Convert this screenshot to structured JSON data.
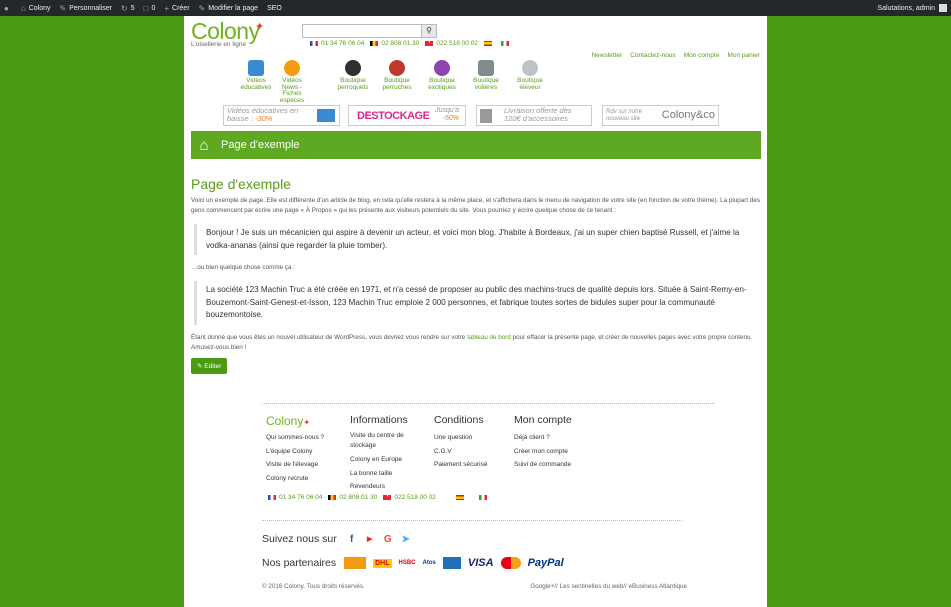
{
  "adminbar": {
    "site": "Colony",
    "customize": "Personnaliser",
    "updates": "5",
    "comments": "0",
    "new": "Créer",
    "edit_page": "Modifier la page",
    "seo": "SEO",
    "greeting": "Salutations, admin"
  },
  "header": {
    "logo": "Colony",
    "tagline": "L'oisellerie en ligne",
    "search_placeholder": "",
    "phones": [
      "01 34 76 06 04",
      "02 808 01 30",
      "022 518 00 02"
    ],
    "links": [
      "Newsletter",
      "Contactez-nous",
      "Mon compte",
      "Mon panier"
    ],
    "cats": [
      {
        "l1": "Vidéos",
        "l2": "éducatives",
        "l3": "",
        "l4": "",
        "color": "#3b8ad1"
      },
      {
        "l1": "Vidéos",
        "l2": "News -",
        "l3": "Fiches",
        "l4": "espèces",
        "color": "#f39c12"
      },
      {
        "l1": "Boutique",
        "l2": "perroquets",
        "l3": "",
        "l4": "",
        "color": "#2f2f2f"
      },
      {
        "l1": "Boutique",
        "l2": "perruches",
        "l3": "",
        "l4": "",
        "color": "#c0392b"
      },
      {
        "l1": "Boutique",
        "l2": "exotiques",
        "l3": "",
        "l4": "",
        "color": "#8e44ad"
      },
      {
        "l1": "Boutique",
        "l2": "volières",
        "l3": "",
        "l4": "",
        "color": "#7f8c8d"
      },
      {
        "l1": "Boutique",
        "l2": "éleveur",
        "l3": "",
        "l4": "",
        "color": "#bdc3c7"
      }
    ],
    "promos": [
      {
        "a": "Vidéos éducatives en",
        "b": "baisse :",
        "c": "-30%"
      },
      {
        "a": "DESTOCKAGE",
        "b": "Jusqu'à",
        "c": "-50%"
      },
      {
        "a": "Livraison offerte dès",
        "b": "120€ d'accessoires",
        "c": ""
      },
      {
        "a": "Rdv sur notre",
        "b": "nouveau site",
        "c": "Colony&co"
      }
    ]
  },
  "hero": {
    "title": "Page d'exemple"
  },
  "content": {
    "title": "Page d'exemple",
    "p1": "Voici un exemple de page. Elle est différente d'un article de blog, en cela qu'elle restera à la même place, et s'affichera dans le menu de navigation de votre site (en fonction de votre thème). La plupart des gens commencent par écrire une page « À Propos » qui les présente aux visiteurs potentiels du site. Vous pourriez y écrire quelque chose de ce tenant :",
    "q1": "Bonjour ! Je suis un mécanicien qui aspire à devenir un acteur, et voici mon blog. J'habite à Bordeaux, j'ai un super chien baptisé Russell, et j'aime la vodka-ananas (ainsi que regarder la pluie tomber).",
    "p2": "…ou bien quelque chose comme ça :",
    "q2": "La société 123 Machin Truc a été créée en 1971, et n'a cessé de proposer au public des machins-trucs de qualité depuis lors. Située à Saint-Remy-en-Bouzemont-Saint-Genest-et-Isson, 123 Machin Truc emploie 2 000 personnes, et fabrique toutes sortes de bidules super pour la communauté bouzemontoise.",
    "p3a": "Étant donné que vous êtes un nouvel utilisateur de WordPress, vous devriez vous rendre sur votre ",
    "p3link": "tableau de bord",
    "p3b": " pour effacer la présente page, et créer de nouvelles pages avec votre propre contenu. Amusez-vous bien !",
    "edit": "Editer"
  },
  "footer": {
    "logo": "Colony",
    "col1": [
      "Qui sommes-nous ?",
      "L'équipe Colony",
      "Visite de l'élevage",
      "Colony recrute"
    ],
    "col2_title": "Informations",
    "col2": [
      "Visite du centre de",
      "stockage",
      "Colony en Europe",
      "La bonne taille",
      "Revendeurs"
    ],
    "col3_title": "Conditions",
    "col3": [
      "Une question",
      "C.G.V",
      "Paiement sécurisé"
    ],
    "col4_title": "Mon compte",
    "col4": [
      "Déjà client ?",
      "Créer mon compte",
      "Suivi de commande"
    ],
    "phones": [
      "01 34 76 06 04",
      "02 808 01 30",
      "022 518 00 02"
    ],
    "follow": "Suivez nous sur",
    "partners": "Nos partenaires",
    "pay": [
      "DHL",
      "HSBC",
      "Atos",
      "VISA",
      "PayPal"
    ],
    "copyright": "© 2016 Colony. Tous droits réservés.",
    "credits": "Google+// Les sentinelles du web// eBusiness Atlantique"
  }
}
